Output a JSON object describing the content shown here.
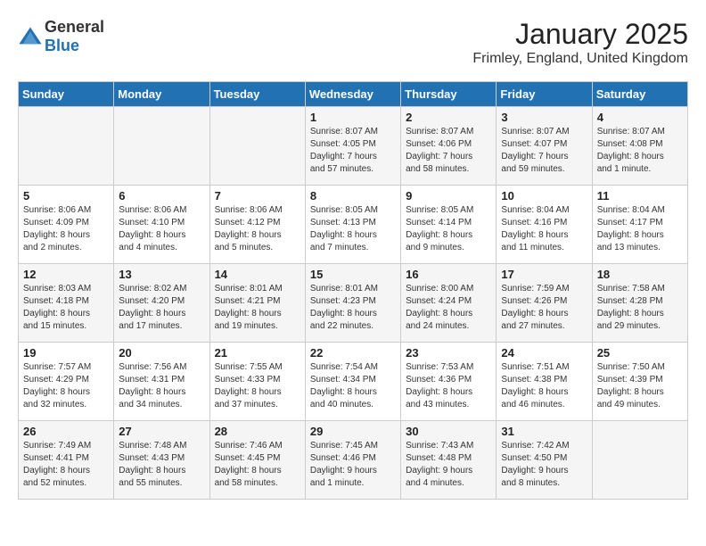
{
  "header": {
    "logo_general": "General",
    "logo_blue": "Blue",
    "title": "January 2025",
    "location": "Frimley, England, United Kingdom"
  },
  "days_of_week": [
    "Sunday",
    "Monday",
    "Tuesday",
    "Wednesday",
    "Thursday",
    "Friday",
    "Saturday"
  ],
  "weeks": [
    [
      {
        "day": "",
        "content": ""
      },
      {
        "day": "",
        "content": ""
      },
      {
        "day": "",
        "content": ""
      },
      {
        "day": "1",
        "content": "Sunrise: 8:07 AM\nSunset: 4:05 PM\nDaylight: 7 hours\nand 57 minutes."
      },
      {
        "day": "2",
        "content": "Sunrise: 8:07 AM\nSunset: 4:06 PM\nDaylight: 7 hours\nand 58 minutes."
      },
      {
        "day": "3",
        "content": "Sunrise: 8:07 AM\nSunset: 4:07 PM\nDaylight: 7 hours\nand 59 minutes."
      },
      {
        "day": "4",
        "content": "Sunrise: 8:07 AM\nSunset: 4:08 PM\nDaylight: 8 hours\nand 1 minute."
      }
    ],
    [
      {
        "day": "5",
        "content": "Sunrise: 8:06 AM\nSunset: 4:09 PM\nDaylight: 8 hours\nand 2 minutes."
      },
      {
        "day": "6",
        "content": "Sunrise: 8:06 AM\nSunset: 4:10 PM\nDaylight: 8 hours\nand 4 minutes."
      },
      {
        "day": "7",
        "content": "Sunrise: 8:06 AM\nSunset: 4:12 PM\nDaylight: 8 hours\nand 5 minutes."
      },
      {
        "day": "8",
        "content": "Sunrise: 8:05 AM\nSunset: 4:13 PM\nDaylight: 8 hours\nand 7 minutes."
      },
      {
        "day": "9",
        "content": "Sunrise: 8:05 AM\nSunset: 4:14 PM\nDaylight: 8 hours\nand 9 minutes."
      },
      {
        "day": "10",
        "content": "Sunrise: 8:04 AM\nSunset: 4:16 PM\nDaylight: 8 hours\nand 11 minutes."
      },
      {
        "day": "11",
        "content": "Sunrise: 8:04 AM\nSunset: 4:17 PM\nDaylight: 8 hours\nand 13 minutes."
      }
    ],
    [
      {
        "day": "12",
        "content": "Sunrise: 8:03 AM\nSunset: 4:18 PM\nDaylight: 8 hours\nand 15 minutes."
      },
      {
        "day": "13",
        "content": "Sunrise: 8:02 AM\nSunset: 4:20 PM\nDaylight: 8 hours\nand 17 minutes."
      },
      {
        "day": "14",
        "content": "Sunrise: 8:01 AM\nSunset: 4:21 PM\nDaylight: 8 hours\nand 19 minutes."
      },
      {
        "day": "15",
        "content": "Sunrise: 8:01 AM\nSunset: 4:23 PM\nDaylight: 8 hours\nand 22 minutes."
      },
      {
        "day": "16",
        "content": "Sunrise: 8:00 AM\nSunset: 4:24 PM\nDaylight: 8 hours\nand 24 minutes."
      },
      {
        "day": "17",
        "content": "Sunrise: 7:59 AM\nSunset: 4:26 PM\nDaylight: 8 hours\nand 27 minutes."
      },
      {
        "day": "18",
        "content": "Sunrise: 7:58 AM\nSunset: 4:28 PM\nDaylight: 8 hours\nand 29 minutes."
      }
    ],
    [
      {
        "day": "19",
        "content": "Sunrise: 7:57 AM\nSunset: 4:29 PM\nDaylight: 8 hours\nand 32 minutes."
      },
      {
        "day": "20",
        "content": "Sunrise: 7:56 AM\nSunset: 4:31 PM\nDaylight: 8 hours\nand 34 minutes."
      },
      {
        "day": "21",
        "content": "Sunrise: 7:55 AM\nSunset: 4:33 PM\nDaylight: 8 hours\nand 37 minutes."
      },
      {
        "day": "22",
        "content": "Sunrise: 7:54 AM\nSunset: 4:34 PM\nDaylight: 8 hours\nand 40 minutes."
      },
      {
        "day": "23",
        "content": "Sunrise: 7:53 AM\nSunset: 4:36 PM\nDaylight: 8 hours\nand 43 minutes."
      },
      {
        "day": "24",
        "content": "Sunrise: 7:51 AM\nSunset: 4:38 PM\nDaylight: 8 hours\nand 46 minutes."
      },
      {
        "day": "25",
        "content": "Sunrise: 7:50 AM\nSunset: 4:39 PM\nDaylight: 8 hours\nand 49 minutes."
      }
    ],
    [
      {
        "day": "26",
        "content": "Sunrise: 7:49 AM\nSunset: 4:41 PM\nDaylight: 8 hours\nand 52 minutes."
      },
      {
        "day": "27",
        "content": "Sunrise: 7:48 AM\nSunset: 4:43 PM\nDaylight: 8 hours\nand 55 minutes."
      },
      {
        "day": "28",
        "content": "Sunrise: 7:46 AM\nSunset: 4:45 PM\nDaylight: 8 hours\nand 58 minutes."
      },
      {
        "day": "29",
        "content": "Sunrise: 7:45 AM\nSunset: 4:46 PM\nDaylight: 9 hours\nand 1 minute."
      },
      {
        "day": "30",
        "content": "Sunrise: 7:43 AM\nSunset: 4:48 PM\nDaylight: 9 hours\nand 4 minutes."
      },
      {
        "day": "31",
        "content": "Sunrise: 7:42 AM\nSunset: 4:50 PM\nDaylight: 9 hours\nand 8 minutes."
      },
      {
        "day": "",
        "content": ""
      }
    ]
  ]
}
